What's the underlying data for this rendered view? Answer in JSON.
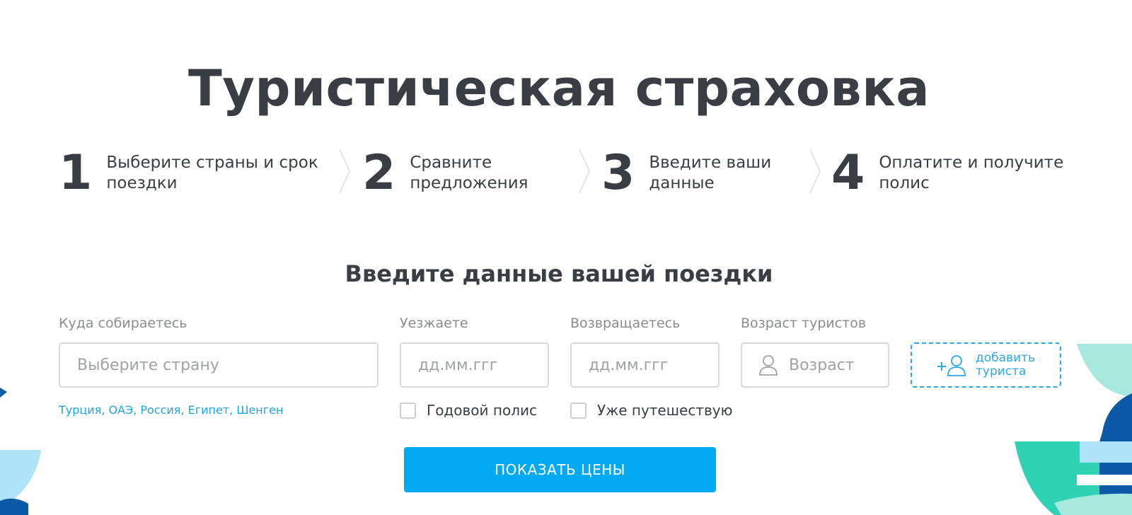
{
  "page": {
    "title": "Туристическая страховка",
    "accent_color": "#04aaf1"
  },
  "steps": [
    {
      "number": "1",
      "text": "Выберите страны и срок\nпоездки"
    },
    {
      "number": "2",
      "text": "Сравните\nпредложения"
    },
    {
      "number": "3",
      "text": "Введите ваши\nданные"
    },
    {
      "number": "4",
      "text": "Оплатите и получите\nполис"
    }
  ],
  "form": {
    "title": "Введите данные вашей поездки",
    "destination": {
      "label": "Куда собираетесь",
      "placeholder": "Выберите страну",
      "suggestions": [
        "Турция",
        "ОАЭ",
        "Россия",
        "Египет",
        "Шенген"
      ]
    },
    "departure": {
      "label": "Уезжаете",
      "placeholder": "дд.мм.ггг"
    },
    "return": {
      "label": "Возвращаетесь",
      "placeholder": "дд.мм.ггг"
    },
    "age": {
      "label": "Возраст туристов",
      "placeholder": "Возраст",
      "icon": "user-icon"
    },
    "add_tourist": {
      "label": "добавить\nтуриста",
      "icon": "add-user-icon"
    },
    "annual_policy": {
      "label": "Годовой полис",
      "checked": false
    },
    "already_travelling": {
      "label": "Уже путешествую",
      "checked": false
    },
    "submit_label": "ПОКАЗАТЬ ЦЕНЫ"
  }
}
